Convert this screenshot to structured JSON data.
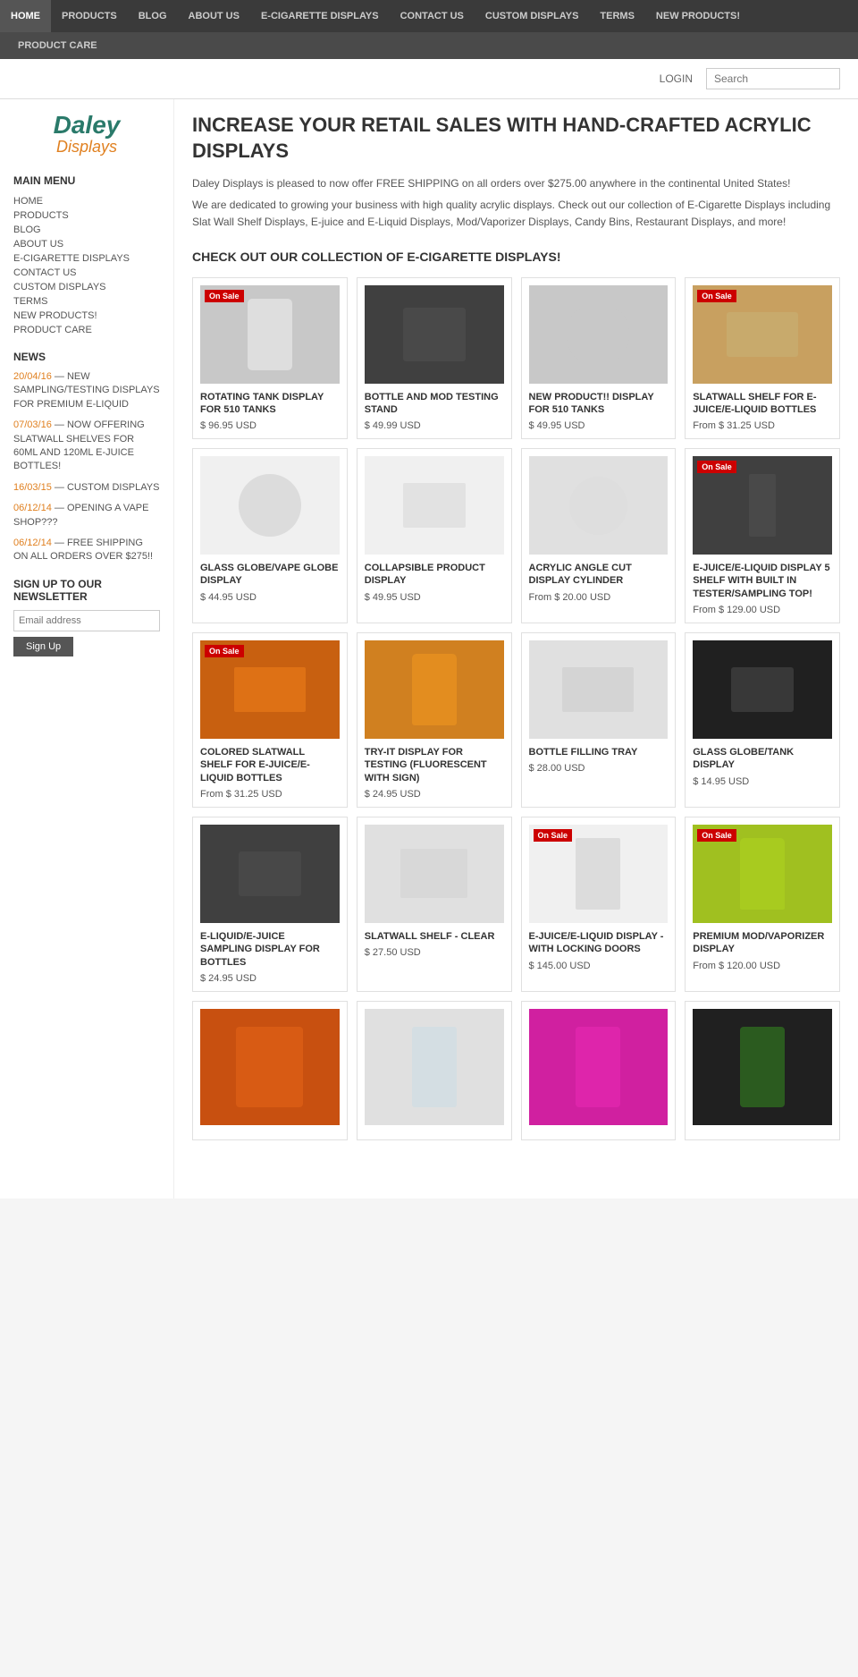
{
  "topnav": {
    "items": [
      {
        "label": "HOME",
        "href": "#",
        "active": true
      },
      {
        "label": "PRODUCTS",
        "href": "#",
        "active": false
      },
      {
        "label": "BLOG",
        "href": "#",
        "active": false
      },
      {
        "label": "ABOUT US",
        "href": "#",
        "active": false
      },
      {
        "label": "E-CIGARETTE DISPLAYS",
        "href": "#",
        "active": false
      },
      {
        "label": "CONTACT US",
        "href": "#",
        "active": false
      },
      {
        "label": "CUSTOM DISPLAYS",
        "href": "#",
        "active": false
      },
      {
        "label": "TERMS",
        "href": "#",
        "active": false
      },
      {
        "label": "NEW PRODUCTS!",
        "href": "#",
        "active": false
      }
    ]
  },
  "secondnav": {
    "items": [
      {
        "label": "PRODUCT CARE",
        "href": "#"
      }
    ]
  },
  "header": {
    "login_label": "LOGIN",
    "search_placeholder": "Search"
  },
  "sidebar": {
    "logo_line1": "Daley",
    "logo_line2": "Displays",
    "main_menu_title": "MAIN MENU",
    "menu_items": [
      {
        "label": "HOME"
      },
      {
        "label": "PRODUCTS"
      },
      {
        "label": "BLOG"
      },
      {
        "label": "ABOUT US"
      },
      {
        "label": "E-CIGARETTE DISPLAYS"
      },
      {
        "label": "CONTACT US"
      },
      {
        "label": "CUSTOM DISPLAYS"
      },
      {
        "label": "TERMS"
      },
      {
        "label": "NEW PRODUCTS!"
      },
      {
        "label": "PRODUCT CARE"
      }
    ],
    "news_title": "NEWS",
    "news_items": [
      {
        "date": "20/04/16",
        "text": "NEW SAMPLING/TESTING DISPLAYS FOR PREMIUM E-LIQUID"
      },
      {
        "date": "07/03/16",
        "text": "NOW OFFERING SLATWALL SHELVES FOR 60ML AND 120ML E-JUICE BOTTLES!"
      },
      {
        "date": "16/03/15",
        "text": "CUSTOM DISPLAYS"
      },
      {
        "date": "06/12/14",
        "text": "OPENING A VAPE SHOP???"
      },
      {
        "date": "06/12/14",
        "text": "FREE SHIPPING ON ALL ORDERS OVER $275!!"
      }
    ],
    "newsletter_title": "SIGN UP TO OUR NEWSLETTER",
    "email_placeholder": "Email address",
    "signup_label": "Sign Up"
  },
  "main": {
    "hero_title": "INCREASE YOUR RETAIL SALES WITH HAND-CRAFTED ACRYLIC DISPLAYS",
    "shipping_notice": "Daley Displays is pleased to now offer FREE SHIPPING on all orders over $275.00 anywhere in the continental United States!",
    "description": "We are dedicated to growing your business with high quality acrylic displays. Check out our collection of E-Cigarette Displays including Slat Wall Shelf Displays, E-juice and E-Liquid Displays, Mod/Vaporizer Displays, Candy Bins, Restaurant Displays, and more!",
    "collection_title": "CHECK OUT OUR COLLECTION OF E-CIGARETTE DISPLAYS!",
    "products": [
      {
        "name": "ROTATING TANK DISPLAY FOR 510 TANKS",
        "price": "$ 96.95 USD",
        "on_sale": true,
        "img_color": "img-gray"
      },
      {
        "name": "BOTTLE AND MOD TESTING STAND",
        "price": "$ 49.99 USD",
        "on_sale": false,
        "img_color": "img-dark"
      },
      {
        "name": "NEW PRODUCT!! DISPLAY FOR 510 TANKS",
        "price": "$ 49.95 USD",
        "on_sale": false,
        "img_color": "img-gray"
      },
      {
        "name": "SLATWALL SHELF FOR E-JUICE/E-LIQUID BOTTLES",
        "price": "From $ 31.25 USD",
        "on_sale": true,
        "img_color": "img-light"
      },
      {
        "name": "GLASS GLOBE/VAPE GLOBE DISPLAY",
        "price": "$ 44.95 USD",
        "on_sale": false,
        "img_color": "img-white"
      },
      {
        "name": "COLLAPSIBLE PRODUCT DISPLAY",
        "price": "$ 49.95 USD",
        "on_sale": false,
        "img_color": "img-white"
      },
      {
        "name": "ACRYLIC ANGLE CUT DISPLAY CYLINDER",
        "price": "From $ 20.00 USD",
        "on_sale": false,
        "img_color": "img-light"
      },
      {
        "name": "E-JUICE/E-LIQUID DISPLAY 5 SHELF WITH BUILT IN TESTER/SAMPLING TOP!",
        "price": "From $ 129.00 USD",
        "on_sale": true,
        "img_color": "img-dark"
      },
      {
        "name": "COLORED SLATWALL SHELF FOR E-JUICE/E-LIQUID BOTTLES",
        "price": "From $ 31.25 USD",
        "on_sale": true,
        "img_color": "img-orange"
      },
      {
        "name": "TRY-IT DISPLAY FOR TESTING (FLUORESCENT WITH SIGN)",
        "price": "$ 24.95 USD",
        "on_sale": false,
        "img_color": "img-orange"
      },
      {
        "name": "BOTTLE FILLING TRAY",
        "price": "$ 28.00 USD",
        "on_sale": false,
        "img_color": "img-light"
      },
      {
        "name": "GLASS GLOBE/TANK DISPLAY",
        "price": "$ 14.95 USD",
        "on_sale": false,
        "img_color": "img-black"
      },
      {
        "name": "E-LIQUID/E-JUICE SAMPLING DISPLAY FOR BOTTLES",
        "price": "$ 24.95 USD",
        "on_sale": false,
        "img_color": "img-dark"
      },
      {
        "name": "SLATWALL SHELF - CLEAR",
        "price": "$ 27.50 USD",
        "on_sale": false,
        "img_color": "img-light"
      },
      {
        "name": "E-JUICE/E-LIQUID DISPLAY - WITH LOCKING DOORS",
        "price": "$ 145.00 USD",
        "on_sale": true,
        "img_color": "img-white"
      },
      {
        "name": "PREMIUM MOD/VAPORIZER DISPLAY",
        "price": "From $ 120.00 USD",
        "on_sale": true,
        "img_color": "img-yellow"
      },
      {
        "name": "",
        "price": "",
        "on_sale": false,
        "img_color": "img-orange"
      },
      {
        "name": "",
        "price": "",
        "on_sale": false,
        "img_color": "img-light"
      },
      {
        "name": "",
        "price": "",
        "on_sale": false,
        "img_color": "img-green"
      },
      {
        "name": "",
        "price": "",
        "on_sale": false,
        "img_color": "img-black"
      }
    ]
  }
}
